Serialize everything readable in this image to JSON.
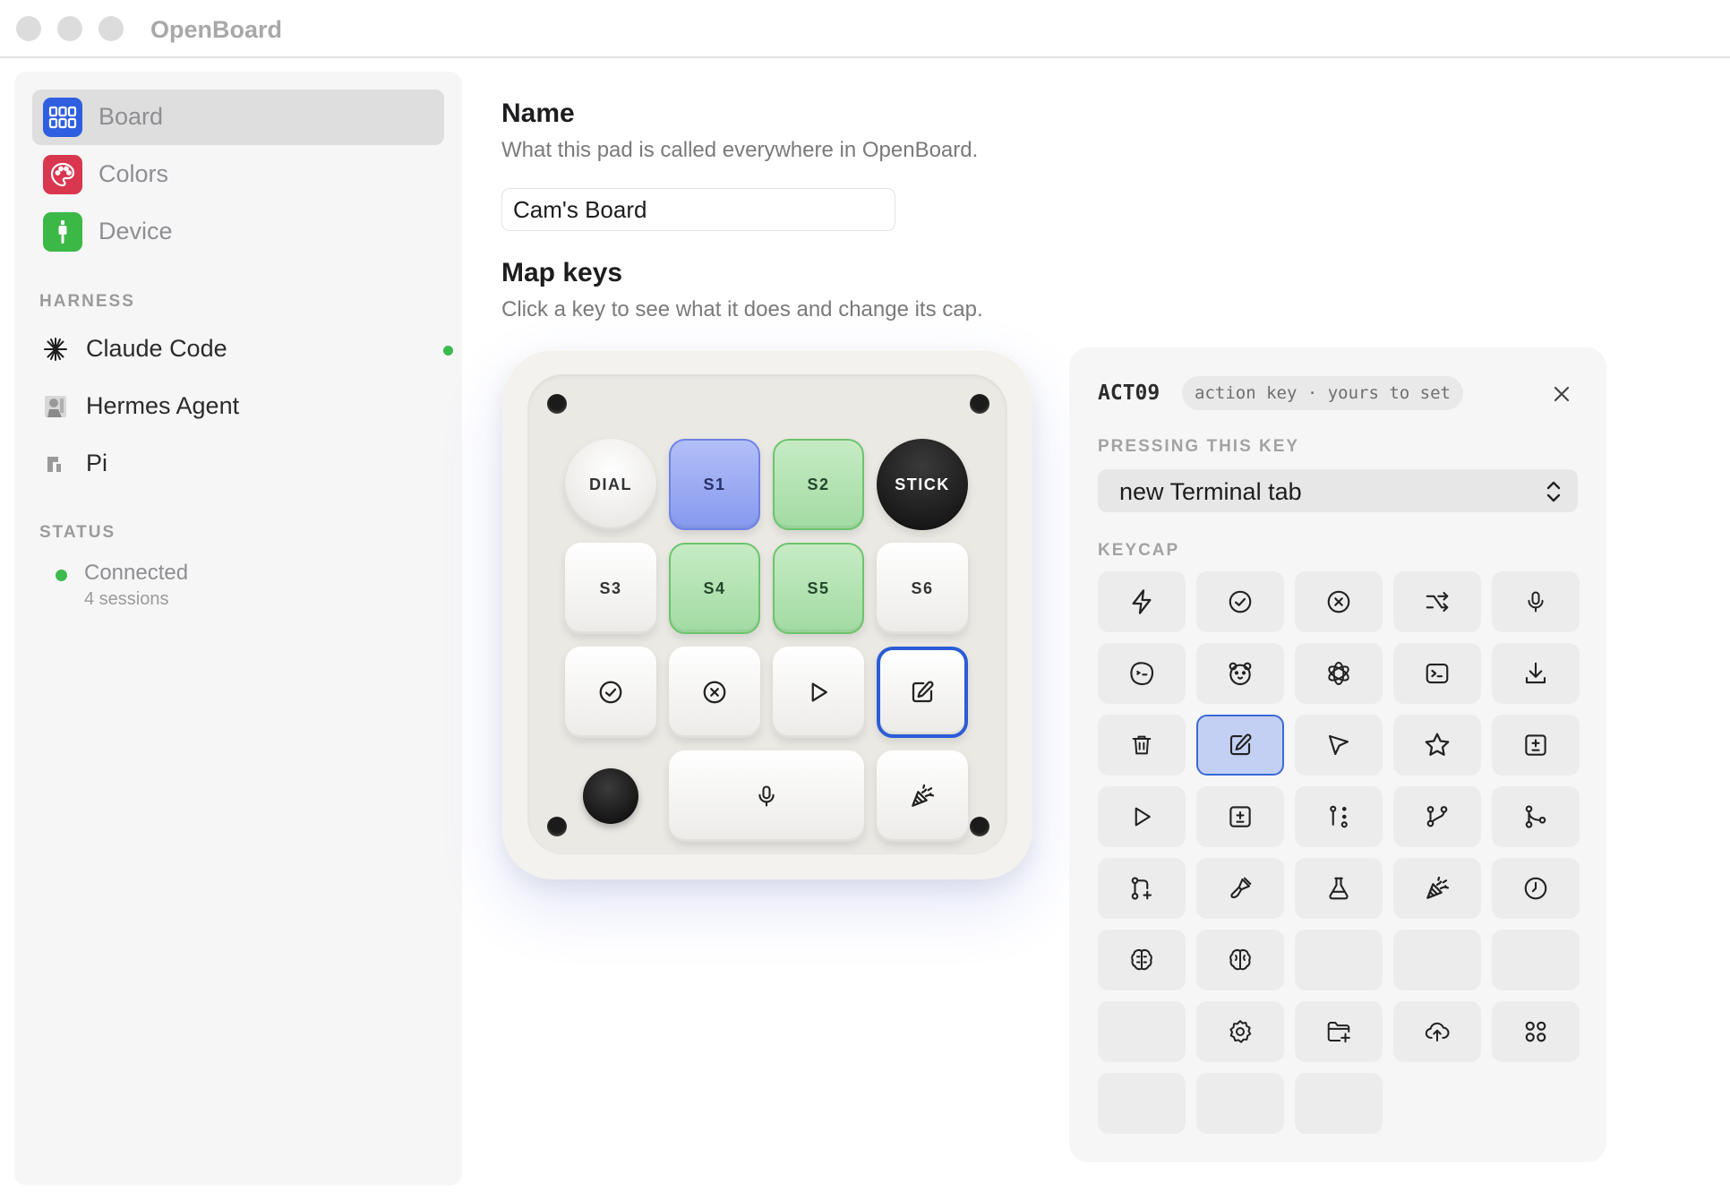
{
  "window": {
    "title": "OpenBoard"
  },
  "sidebar": {
    "nav": [
      {
        "label": "Board",
        "icon": "grid-icon",
        "color": "#2f5fe0",
        "selected": true
      },
      {
        "label": "Colors",
        "icon": "palette-icon",
        "color": "#d9364f"
      },
      {
        "label": "Device",
        "icon": "device-icon",
        "color": "#3cb847"
      }
    ],
    "harness_heading": "HARNESS",
    "harness": [
      {
        "label": "Claude Code",
        "icon": "asterisk-icon",
        "active": true
      },
      {
        "label": "Hermes Agent",
        "icon": "statue-icon"
      },
      {
        "label": "Pi",
        "icon": "pi-icon"
      }
    ],
    "status_heading": "STATUS",
    "status": {
      "label": "Connected",
      "detail": "4 sessions",
      "color": "#3dba4e"
    }
  },
  "main": {
    "name_section": {
      "title": "Name",
      "description": "What this pad is called everywhere in OpenBoard.",
      "value": "Cam's Board"
    },
    "map_section": {
      "title": "Map keys",
      "description": "Click a key to see what it does and change its cap."
    },
    "keys": {
      "dial": "DIAL",
      "s1": "S1",
      "s2": "S2",
      "stick": "STICK",
      "s3": "S3",
      "s4": "S4",
      "s5": "S5",
      "s6": "S6"
    }
  },
  "panel": {
    "key_id": "ACT09",
    "badge": "action key · yours to set",
    "pressing_heading": "PRESSING THIS KEY",
    "pressing_value": "new Terminal tab",
    "keycap_heading": "KEYCAP",
    "keycaps": [
      "zap-icon",
      "check-circle-icon",
      "x-circle-icon",
      "shuffle-icon",
      "mic-icon",
      "claude-face-icon",
      "bear-face-icon",
      "openai-icon",
      "terminal-square-icon",
      "download-icon",
      "trash-icon",
      "edit-icon",
      "cursor-icon",
      "star-icon",
      "plus-minus-square-icon",
      "play-icon",
      "diff-square-icon",
      "git-commit-icon",
      "git-branch-icon",
      "git-merge-icon",
      "git-pull-request-icon",
      "brush-icon",
      "flask-icon",
      "party-popper-icon",
      "clock-icon",
      "brain-circuit-icon",
      "brain-icon",
      "blank",
      "blank",
      "blank",
      "blank",
      "settings-icon",
      "folder-plus-icon",
      "cloud-upload-icon",
      "apps-icon",
      "blank",
      "blank",
      "blank"
    ],
    "selected_keycap_index": 11,
    "accent_color": "#2b5cd6"
  }
}
